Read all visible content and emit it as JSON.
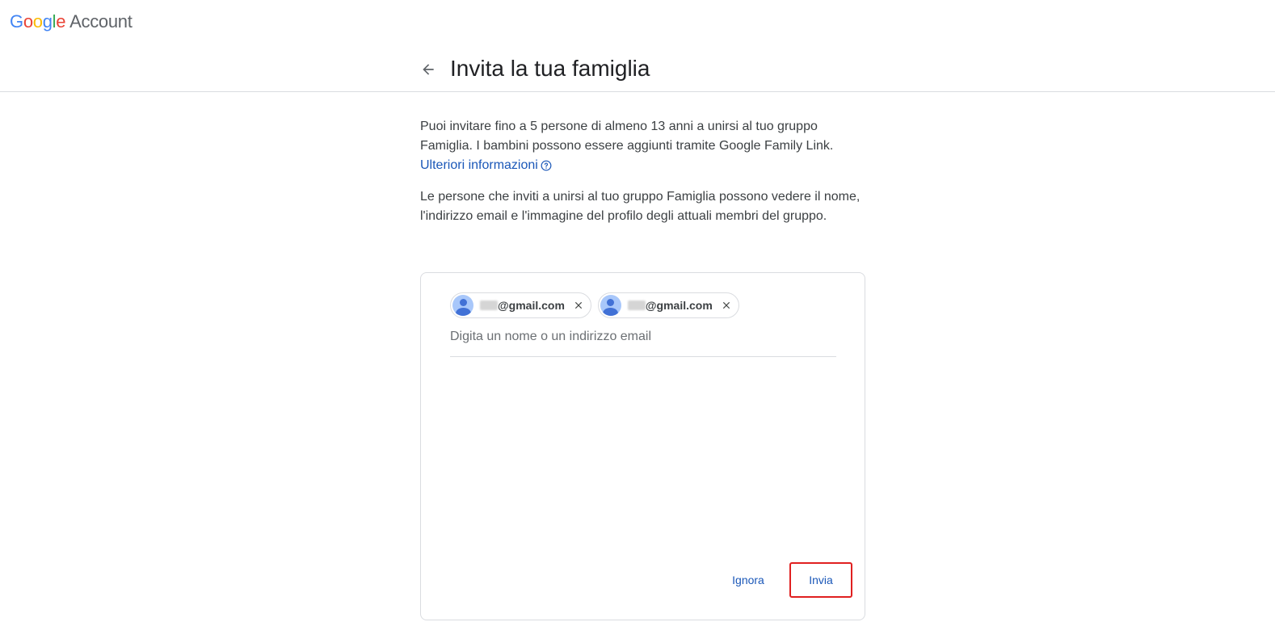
{
  "header": {
    "logo_letters": [
      "G",
      "o",
      "o",
      "g",
      "l",
      "e"
    ],
    "logo_suffix": "Account",
    "back_icon": "arrow-back-icon",
    "title": "Invita la tua famiglia"
  },
  "description": {
    "paragraph1": "Puoi invitare fino a 5 persone di almeno 13 anni a unirsi al tuo gruppo Famiglia. I bambini possono essere aggiunti tramite Google Family Link.",
    "learn_more_link": "Ulteriori informazioni",
    "help_icon": "help-circle-icon",
    "paragraph2": "Le persone che inviti a unirsi al tuo gruppo Famiglia possono vedere il nome, l'indirizzo email e l'immagine del profilo degli attuali membri del gruppo."
  },
  "invite": {
    "recipients": [
      {
        "email_visible": "@gmail.com",
        "avatar_icon": "person-avatar-icon",
        "remove_icon": "close-icon"
      },
      {
        "email_visible": "@gmail.com",
        "avatar_icon": "person-avatar-icon",
        "remove_icon": "close-icon"
      }
    ],
    "input_value": "",
    "input_placeholder": "Digita un nome o un indirizzo email",
    "ignore_label": "Ignora",
    "send_label": "Invia"
  },
  "colors": {
    "link": "#1a57b8",
    "highlight_border": "#e02020",
    "avatar_bg": "#a8c7fa",
    "avatar_fg": "#4171d6"
  }
}
